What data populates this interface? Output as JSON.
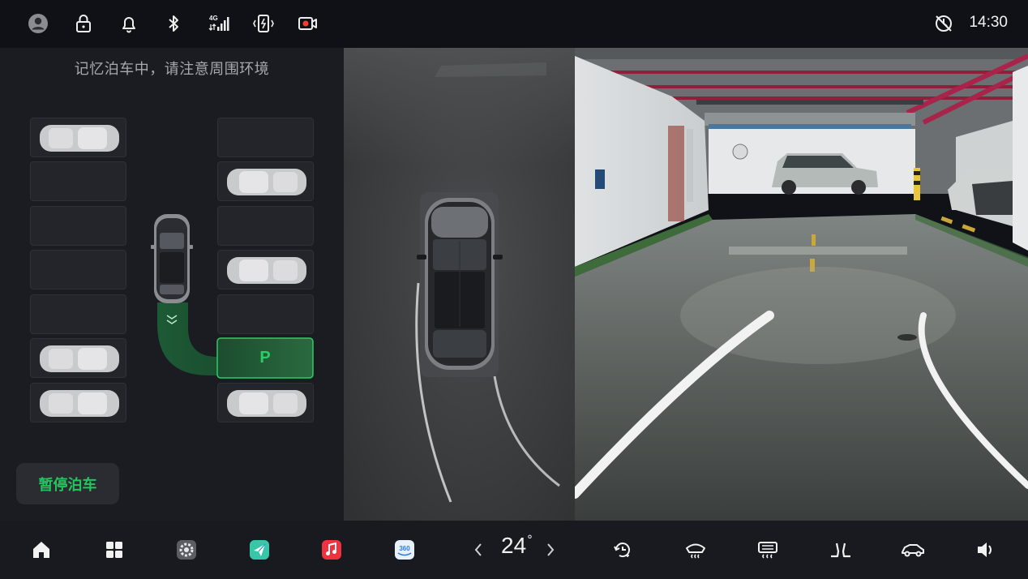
{
  "status_bar": {
    "time": "14:30",
    "network_label": "4G",
    "icons": [
      "avatar-icon",
      "lock-icon",
      "bell-icon",
      "bluetooth-icon",
      "signal-4g-icon",
      "vibrate-icon",
      "dashcam-record-icon",
      "do-not-disturb-icon"
    ]
  },
  "parking": {
    "hint": "记忆泊车中，请注意周围环境",
    "target_label": "P",
    "pause_button": "暂停泊车"
  },
  "dock": {
    "temperature": "24",
    "degree_symbol": "°",
    "apps": [
      "home-icon",
      "apps-grid-icon",
      "settings-app-icon",
      "navigation-app-icon",
      "music-app-icon",
      "camera-360-app-icon"
    ],
    "controls": [
      "air-recirculation-icon",
      "front-defrost-icon",
      "rear-defrost-icon",
      "seat-heating-icon",
      "vehicle-icon",
      "volume-icon"
    ]
  },
  "colors": {
    "accent_green": "#22c55e",
    "record_red": "#ff3b30"
  }
}
